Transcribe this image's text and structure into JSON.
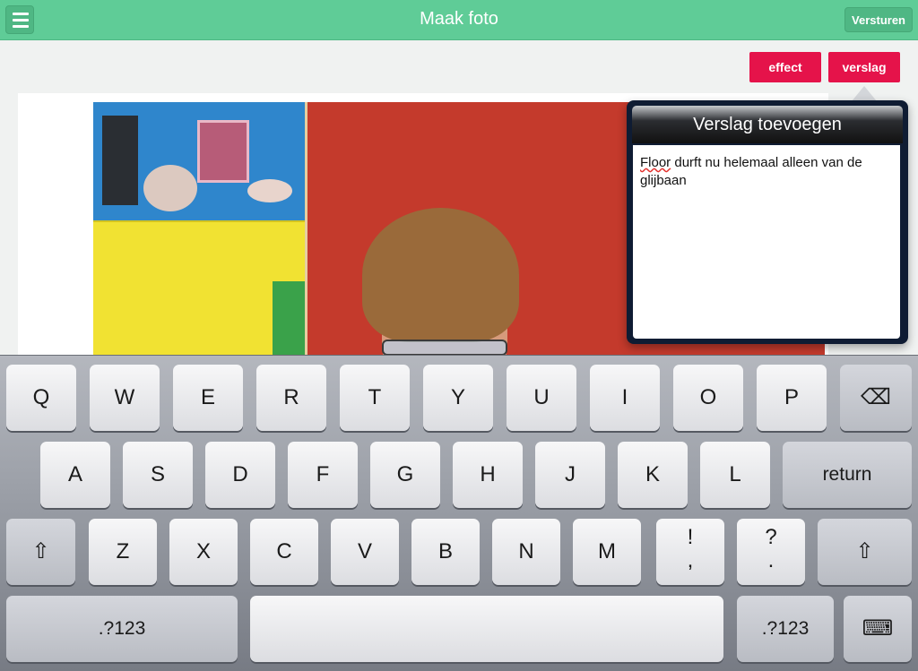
{
  "header": {
    "title": "Maak foto",
    "send_label": "Versturen"
  },
  "actions": {
    "effect_label": "effect",
    "report_label": "verslag"
  },
  "popover": {
    "title": "Verslag toevoegen",
    "text_part1": "Floor",
    "text_part2": " durft nu helemaal alleen van de glijbaan"
  },
  "keyboard": {
    "row1": [
      "Q",
      "W",
      "E",
      "R",
      "T",
      "Y",
      "U",
      "I",
      "O",
      "P"
    ],
    "row2": [
      "A",
      "S",
      "D",
      "F",
      "G",
      "H",
      "J",
      "K",
      "L"
    ],
    "row3": [
      "Z",
      "X",
      "C",
      "V",
      "B",
      "N",
      "M"
    ],
    "return_label": "return",
    "exclaim_top": "!",
    "exclaim_bottom": ",",
    "question_top": "?",
    "question_bottom": ".",
    "numbers_label": ".?123",
    "shift_symbol": "⇧",
    "backspace_symbol": "⌫",
    "hide_symbol": "⌨"
  },
  "colors": {
    "header": "#5fcc97",
    "accent_button": "#e5134a",
    "popover_frame": "#0f1c33"
  },
  "icons": [
    "hamburger-menu-icon",
    "backspace-icon",
    "shift-icon",
    "hide-keyboard-icon"
  ]
}
